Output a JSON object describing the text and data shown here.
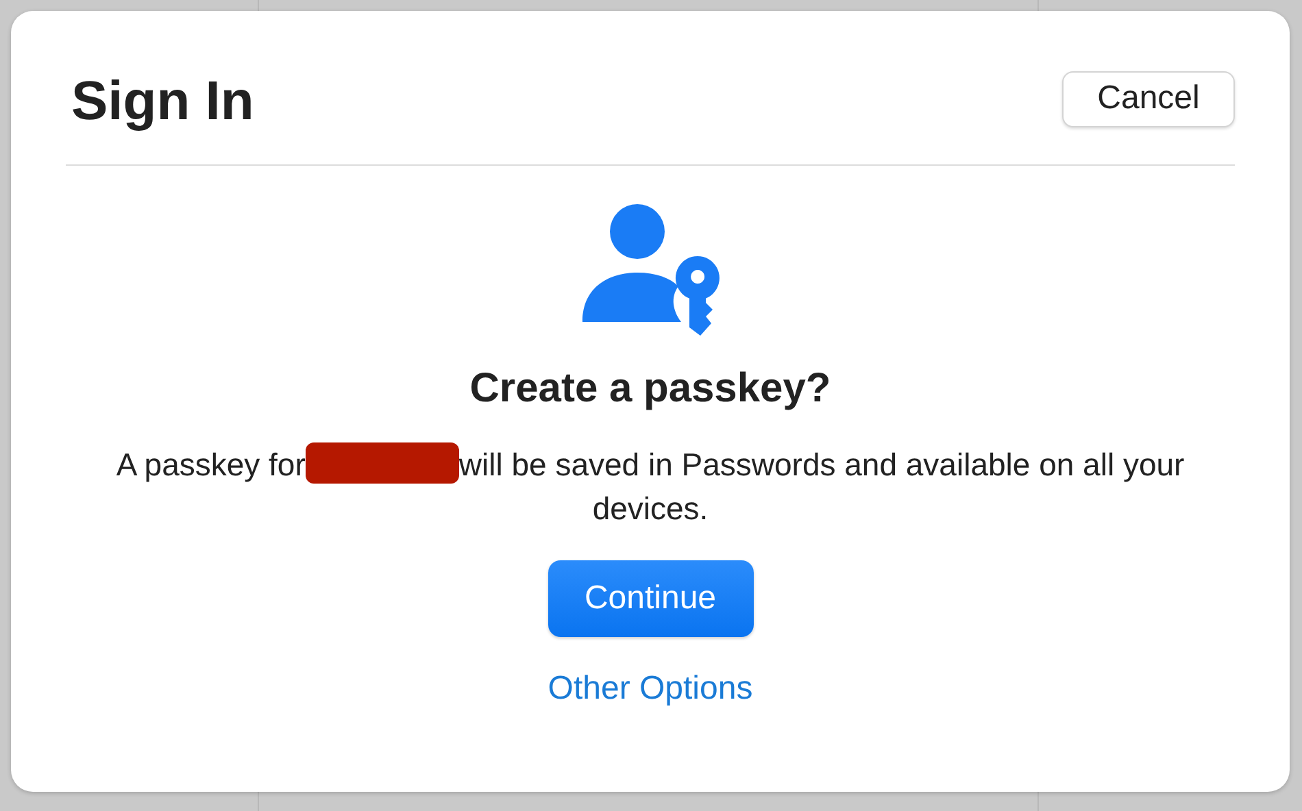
{
  "dialog": {
    "title": "Sign In",
    "cancel_button": "Cancel",
    "heading": "Create a passkey?",
    "message": {
      "before": "A passkey for",
      "redacted": true,
      "after": "will be saved in Passwords and available on all your devices."
    },
    "primary_button": "Continue",
    "link": "Other Options"
  }
}
